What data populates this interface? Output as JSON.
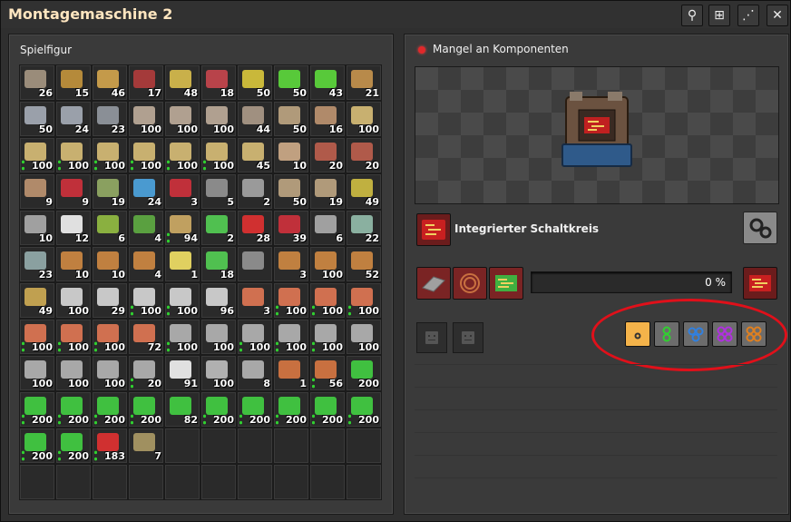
{
  "window": {
    "title": "Montagemaschine 2"
  },
  "titlebar_buttons": [
    {
      "name": "search-button",
      "icon": "search-icon",
      "glyph": "⚲"
    },
    {
      "name": "network-button",
      "icon": "tech-tree-icon",
      "glyph": "⊞"
    },
    {
      "name": "wifi-button",
      "icon": "signal-icon",
      "glyph": "⋰"
    },
    {
      "name": "close-button",
      "icon": "close-icon",
      "glyph": "✕"
    }
  ],
  "inventory": {
    "title": "Spielfigur",
    "rows": [
      [
        {
          "c": "26",
          "col": "#9a8c7a"
        },
        {
          "c": "15",
          "col": "#b58a3a"
        },
        {
          "c": "46",
          "col": "#c49a4a"
        },
        {
          "c": "17",
          "col": "#a43a3a"
        },
        {
          "c": "48",
          "col": "#c9b04a"
        },
        {
          "c": "18",
          "col": "#b8434a"
        },
        {
          "c": "50",
          "col": "#c9b83a"
        },
        {
          "c": "50",
          "col": "#58c93a"
        },
        {
          "c": "43",
          "col": "#58c93a"
        },
        {
          "c": "21",
          "col": "#b88a4a"
        }
      ],
      [
        {
          "c": "50",
          "col": "#9aa0aa"
        },
        {
          "c": "24",
          "col": "#9aa0aa"
        },
        {
          "c": "23",
          "col": "#8a8f96"
        },
        {
          "c": "100",
          "col": "#b0a090"
        },
        {
          "c": "100",
          "col": "#b0a090"
        },
        {
          "c": "100",
          "col": "#b0a090"
        },
        {
          "c": "44",
          "col": "#a09080"
        },
        {
          "c": "50",
          "col": "#b09a7a"
        },
        {
          "c": "16",
          "col": "#b08a6a"
        },
        {
          "c": "100",
          "col": "#c8b070"
        }
      ],
      [
        {
          "c": "100",
          "col": "#c8b070",
          "g": true
        },
        {
          "c": "100",
          "col": "#c8b070",
          "g": true
        },
        {
          "c": "100",
          "col": "#c8b070",
          "g": true
        },
        {
          "c": "100",
          "col": "#c8b070",
          "g": true
        },
        {
          "c": "100",
          "col": "#c8b070",
          "g": true
        },
        {
          "c": "100",
          "col": "#c8b070",
          "g": true
        },
        {
          "c": "45",
          "col": "#c8b070"
        },
        {
          "c": "10",
          "col": "#c0a080"
        },
        {
          "c": "20",
          "col": "#b05a4a"
        },
        {
          "c": "20",
          "col": "#b05a4a"
        }
      ],
      [
        {
          "c": "9",
          "col": "#b08a6a"
        },
        {
          "c": "9",
          "col": "#c0303a"
        },
        {
          "c": "19",
          "col": "#8aa060"
        },
        {
          "c": "24",
          "col": "#4a9ad0"
        },
        {
          "c": "3",
          "col": "#c0303a"
        },
        {
          "c": "5",
          "col": "#8a8a8a"
        },
        {
          "c": "2",
          "col": "#9a9a9a"
        },
        {
          "c": "50",
          "col": "#b09a7a"
        },
        {
          "c": "19",
          "col": "#b09a7a"
        },
        {
          "c": "49",
          "col": "#c0b040"
        }
      ],
      [
        {
          "c": "10",
          "col": "#a0a0a0"
        },
        {
          "c": "12",
          "col": "#e0e0e0"
        },
        {
          "c": "6",
          "col": "#8ab040"
        },
        {
          "c": "4",
          "col": "#5aa040"
        },
        {
          "c": "94",
          "col": "#c0a060",
          "g": true
        },
        {
          "c": "2",
          "col": "#50c050"
        },
        {
          "c": "28",
          "col": "#d03030"
        },
        {
          "c": "39",
          "col": "#c0303a"
        },
        {
          "c": "6",
          "col": "#a0a0a0"
        },
        {
          "c": "22",
          "col": "#8ab0a0"
        }
      ],
      [
        {
          "c": "23",
          "col": "#8aa0a0"
        },
        {
          "c": "10",
          "col": "#c08040"
        },
        {
          "c": "10",
          "col": "#c08040"
        },
        {
          "c": "4",
          "col": "#c08040"
        },
        {
          "c": "1",
          "col": "#e0d060"
        },
        {
          "c": "18",
          "col": "#50c050"
        },
        {
          "c": "",
          "col": "#8a8a8a"
        },
        {
          "c": "3",
          "col": "#c08040"
        },
        {
          "c": "100",
          "col": "#c08040"
        },
        {
          "c": "52",
          "col": "#c08040"
        }
      ],
      [
        {
          "c": "49",
          "col": "#c0a050"
        },
        {
          "c": "100",
          "col": "#c8c8c8"
        },
        {
          "c": "29",
          "col": "#c8c8c8"
        },
        {
          "c": "100",
          "col": "#c8c8c8",
          "g": true
        },
        {
          "c": "100",
          "col": "#c8c8c8",
          "g": true
        },
        {
          "c": "96",
          "col": "#c8c8c8"
        },
        {
          "c": "3",
          "col": "#d07050"
        },
        {
          "c": "100",
          "col": "#d07050",
          "g": true
        },
        {
          "c": "100",
          "col": "#d07050",
          "g": true
        },
        {
          "c": "100",
          "col": "#d07050",
          "g": true
        }
      ],
      [
        {
          "c": "100",
          "col": "#d07050",
          "g": true
        },
        {
          "c": "100",
          "col": "#d07050",
          "g": true
        },
        {
          "c": "100",
          "col": "#d07050",
          "g": true
        },
        {
          "c": "72",
          "col": "#d07050"
        },
        {
          "c": "100",
          "col": "#a8a8a8",
          "g": true
        },
        {
          "c": "100",
          "col": "#a8a8a8"
        },
        {
          "c": "100",
          "col": "#a8a8a8",
          "g": true
        },
        {
          "c": "100",
          "col": "#a8a8a8",
          "g": true
        },
        {
          "c": "100",
          "col": "#a8a8a8",
          "g": true
        },
        {
          "c": "100",
          "col": "#a8a8a8"
        }
      ],
      [
        {
          "c": "100",
          "col": "#a8a8a8"
        },
        {
          "c": "100",
          "col": "#a8a8a8"
        },
        {
          "c": "100",
          "col": "#a8a8a8"
        },
        {
          "c": "20",
          "col": "#a8a8a8",
          "g": true
        },
        {
          "c": "91",
          "col": "#e0e0e0"
        },
        {
          "c": "100",
          "col": "#b0b0b0"
        },
        {
          "c": "8",
          "col": "#a8a8a8"
        },
        {
          "c": "1",
          "col": "#c87040"
        },
        {
          "c": "56",
          "col": "#c87040",
          "g": true
        },
        {
          "c": "200",
          "col": "#40c040"
        }
      ],
      [
        {
          "c": "200",
          "col": "#40c040",
          "g": true
        },
        {
          "c": "200",
          "col": "#40c040",
          "g": true
        },
        {
          "c": "200",
          "col": "#40c040",
          "g": true
        },
        {
          "c": "200",
          "col": "#40c040",
          "g": true
        },
        {
          "c": "82",
          "col": "#40c040"
        },
        {
          "c": "200",
          "col": "#40c040",
          "g": true
        },
        {
          "c": "200",
          "col": "#40c040",
          "g": true
        },
        {
          "c": "200",
          "col": "#40c040",
          "g": true
        },
        {
          "c": "200",
          "col": "#40c040",
          "g": true
        },
        {
          "c": "200",
          "col": "#40c040",
          "g": true
        }
      ],
      [
        {
          "c": "200",
          "col": "#40c040",
          "g": true
        },
        {
          "c": "200",
          "col": "#40c040",
          "g": true
        },
        {
          "c": "183",
          "col": "#d03030",
          "g": true
        },
        {
          "c": "7",
          "col": "#a09060"
        },
        {
          "c": "",
          "col": ""
        },
        {
          "c": "",
          "col": ""
        },
        {
          "c": "",
          "col": ""
        },
        {
          "c": "",
          "col": ""
        },
        {
          "c": "",
          "col": ""
        },
        {
          "c": "",
          "col": ""
        }
      ],
      [
        {
          "c": "",
          "col": ""
        },
        {
          "c": "",
          "col": ""
        },
        {
          "c": "",
          "col": ""
        },
        {
          "c": "",
          "col": ""
        },
        {
          "c": "",
          "col": ""
        },
        {
          "c": "",
          "col": ""
        },
        {
          "c": "",
          "col": ""
        },
        {
          "c": "",
          "col": ""
        },
        {
          "c": "",
          "col": ""
        },
        {
          "c": "",
          "col": ""
        }
      ]
    ]
  },
  "machine": {
    "status": "Mangel an Komponenten",
    "status_color": "#e0282a",
    "recipe_label": "Integrierter Schaltkreis",
    "progress_text": "0 %",
    "progress": 0,
    "ingredients_colors": [
      "#8a8a8a",
      "#c87040",
      "#40c040"
    ],
    "output_color": "#d03030"
  },
  "module_tiers": [
    {
      "name": "tier-1",
      "selected": true,
      "dots": [
        "#333"
      ]
    },
    {
      "name": "tier-2",
      "selected": false,
      "dots": [
        "#30d030",
        "#30d030"
      ]
    },
    {
      "name": "tier-3",
      "selected": false,
      "dots": [
        "#3080e0",
        "#3080e0",
        "#3080e0"
      ]
    },
    {
      "name": "tier-4",
      "selected": false,
      "dots": [
        "#b030e0",
        "#b030e0",
        "#b030e0",
        "#b030e0"
      ]
    },
    {
      "name": "tier-5",
      "selected": false,
      "dots": [
        "#e08020",
        "#e08020",
        "#e08020",
        "#e08020"
      ]
    }
  ]
}
